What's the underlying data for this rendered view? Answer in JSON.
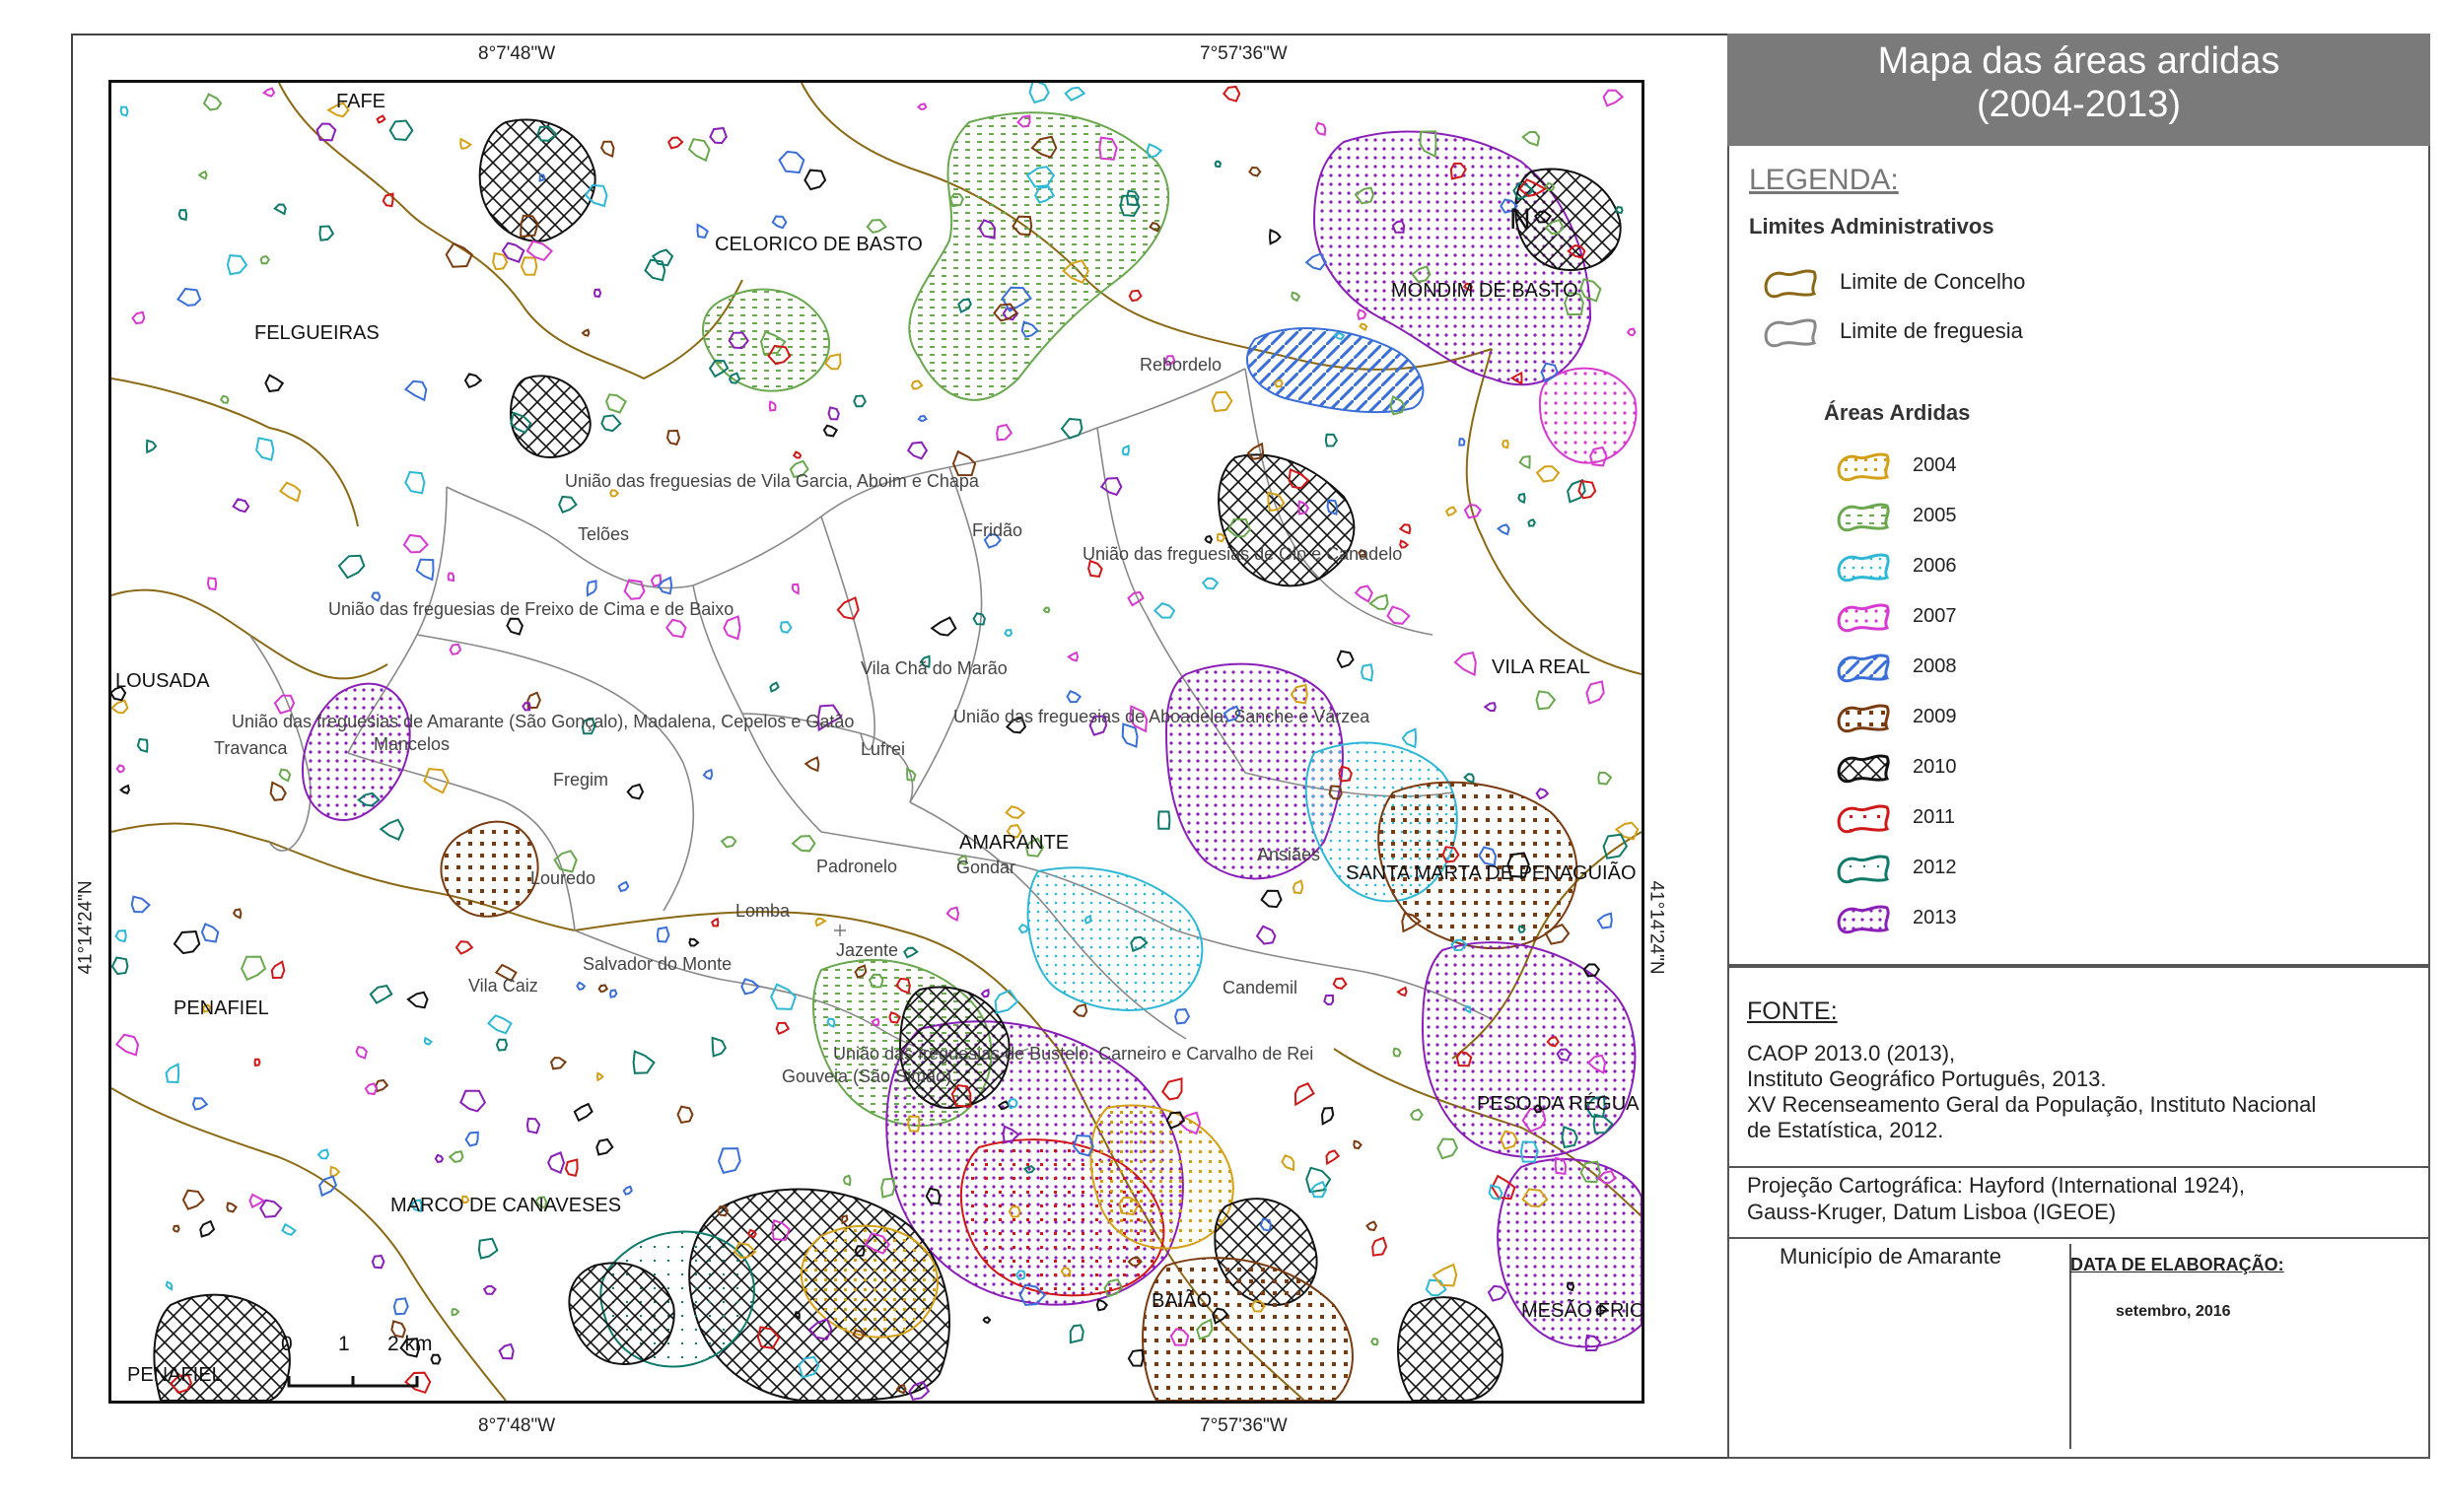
{
  "title": {
    "line1": "Mapa das áreas ardidas",
    "line2": "(2004-2013)"
  },
  "coords": {
    "top_left": "8°7'48\"W",
    "top_right": "7°57'36\"W",
    "bottom_left": "8°7'48\"W",
    "bottom_right": "7°57'36\"W",
    "left": "41°14'24\"N",
    "right": "41°14'24\"N"
  },
  "places": {
    "fafe": "FAFE",
    "celorico": "CELORICO DE BASTO",
    "mondim": "MONDIM DE BASTO",
    "felgueiras": "FELGUEIRAS",
    "rebordelo": "Rebordelo",
    "vila_garcia": "União das freguesias de Vila Garcia, Aboim e Chapa",
    "teloes": "Telões",
    "fridao": "Fridão",
    "olo": "União das freguesias de Olo e Canadelo",
    "freixo": "União das freguesias de Freixo de Cima e de Baixo",
    "lousada": "LOUSADA",
    "vila_real": "VILA REAL",
    "vila_cha": "Vila Chã do Marão",
    "amarante_uf": "União das freguesias de Amarante (São Gonçalo), Madalena, Cepelos e Gatão",
    "aboadela": "União das freguesias de Aboadela, Sanche e Várzea",
    "travanca": "Travanca",
    "mancelos": "Mancelos",
    "lufrei": "Lufrei",
    "fregim": "Fregim",
    "amarante": "AMARANTE",
    "gondar": "Gondar",
    "ansiaes": "Ansiães",
    "santa_marta": "SANTA MARTA DE PENAGUIÃO",
    "louredo": "Louredo",
    "padronelo": "Padronelo",
    "lomba": "Lomba",
    "salvador": "Salvador do Monte",
    "jazente": "Jazente",
    "penafiel": "PENAFIEL",
    "vila_caiz": "Vila Caiz",
    "candemil": "Candemil",
    "bustelo": "União das freguesias de Bustelo, Carneiro e Carvalho de Rei",
    "gouveia": "Gouveia (São Simão)",
    "peso_regua": "PESO DA RÉGUA",
    "marco": "MARCO DE CANAVESES",
    "baiao": "BAIÃO",
    "mesao_frio": "MESÃO FRIO",
    "penafiel2": "PENAFIEL",
    "north": "N"
  },
  "scale": {
    "zero": "0",
    "one": "1",
    "two": "2 km"
  },
  "legend": {
    "heading": "LEGENDA:",
    "admin_title": "Limites Administrativos",
    "concelho": "Limite de Concelho",
    "freguesia": "Limite de freguesia",
    "burned_title": "Áreas Ardidas",
    "years": [
      {
        "label": "2004",
        "color": "#d4a017"
      },
      {
        "label": "2005",
        "color": "#6aa84f"
      },
      {
        "label": "2006",
        "color": "#2eb8d6"
      },
      {
        "label": "2007",
        "color": "#d63ad0"
      },
      {
        "label": "2008",
        "color": "#3b6fd8"
      },
      {
        "label": "2009",
        "color": "#7a3b10"
      },
      {
        "label": "2010",
        "color": "#111111"
      },
      {
        "label": "2011",
        "color": "#d01818"
      },
      {
        "label": "2012",
        "color": "#0f7a6a"
      },
      {
        "label": "2013",
        "color": "#8a1fb8"
      }
    ]
  },
  "source": {
    "heading": "FONTE:",
    "lines": [
      "CAOP 2013.0 (2013),",
      "Instituto Geográfico Português, 2013.",
      "XV Recenseamento Geral da População, Instituto Nacional",
      "de Estatística, 2012."
    ]
  },
  "projection": {
    "line1": "Projeção Cartográfica: Hayford (International 1924),",
    "line2": "Gauss-Kruger, Datum Lisboa (IGEOE)"
  },
  "footer": {
    "municipality": "Município de Amarante",
    "date_label": "DATA DE ELABORAÇÃO:",
    "date_value": "setembro, 2016"
  }
}
